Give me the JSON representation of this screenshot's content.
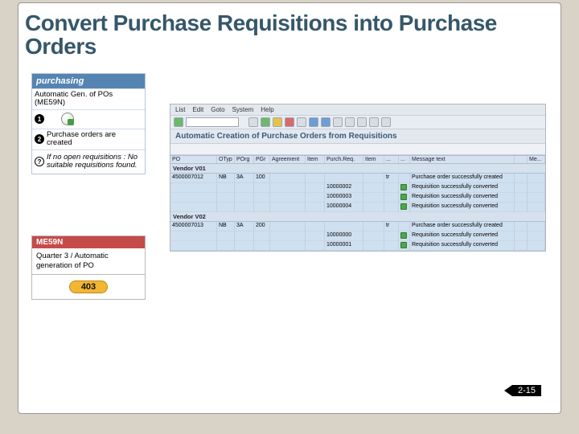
{
  "title": "Convert Purchase Requisitions into Purchase Orders",
  "purchasing": {
    "header": "purchasing",
    "sub": "Automatic Gen. of POs (ME59N)",
    "steps": [
      {
        "num": "1",
        "text": ""
      },
      {
        "num": "2",
        "text": "Purchase orders are created"
      },
      {
        "num": "?",
        "text": "If no open requisitions : No suitable requisitions found."
      }
    ]
  },
  "tcode": {
    "code": "ME59N",
    "desc": "Quarter 3 / Automatic generation of PO",
    "page": "403"
  },
  "sap": {
    "menu": [
      "List",
      "Edit",
      "Goto",
      "System",
      "Help"
    ],
    "title": "Automatic Creation of Purchase Orders from Requisitions",
    "columns": [
      "PO",
      "OTyp",
      "POrg",
      "PGr",
      "Agreement",
      "Item",
      "Purch.Req.",
      "Item",
      "...",
      "...",
      "Message text",
      "",
      "Me..."
    ],
    "groups": [
      {
        "vendor": "Vendor V01",
        "rows": [
          {
            "po": "4500007012",
            "otyp": "NB",
            "porg": "3A",
            "pgr": "100",
            "agreement": "",
            "item": "",
            "req": "",
            "reqitem": "",
            "m": "",
            "d": "tr",
            "msg": "Purchase order successfully created"
          },
          {
            "po": "",
            "otyp": "",
            "porg": "",
            "pgr": "",
            "agreement": "",
            "item": "",
            "req": "10000002",
            "reqitem": "",
            "m": "G",
            "d": "",
            "msg": "Requisition successfully converted"
          },
          {
            "po": "",
            "otyp": "",
            "porg": "",
            "pgr": "",
            "agreement": "",
            "item": "",
            "req": "10000003",
            "reqitem": "",
            "m": "G",
            "d": "",
            "msg": "Requisition successfully converted"
          },
          {
            "po": "",
            "otyp": "",
            "porg": "",
            "pgr": "",
            "agreement": "",
            "item": "",
            "req": "10000004",
            "reqitem": "",
            "m": "G",
            "d": "",
            "msg": "Requisition successfully converted"
          }
        ]
      },
      {
        "vendor": "Vendor V02",
        "rows": [
          {
            "po": "4500007013",
            "otyp": "NB",
            "porg": "3A",
            "pgr": "200",
            "agreement": "",
            "item": "",
            "req": "",
            "reqitem": "",
            "m": "",
            "d": "tr",
            "msg": "Purchase order successfully created"
          },
          {
            "po": "",
            "otyp": "",
            "porg": "",
            "pgr": "",
            "agreement": "",
            "item": "",
            "req": "10000000",
            "reqitem": "",
            "m": "G",
            "d": "",
            "msg": "Requisition successfully converted"
          },
          {
            "po": "",
            "otyp": "",
            "porg": "",
            "pgr": "",
            "agreement": "",
            "item": "",
            "req": "10000001",
            "reqitem": "",
            "m": "G",
            "d": "",
            "msg": "Requisition successfully converted"
          }
        ]
      }
    ]
  },
  "slide_num": "2-15"
}
